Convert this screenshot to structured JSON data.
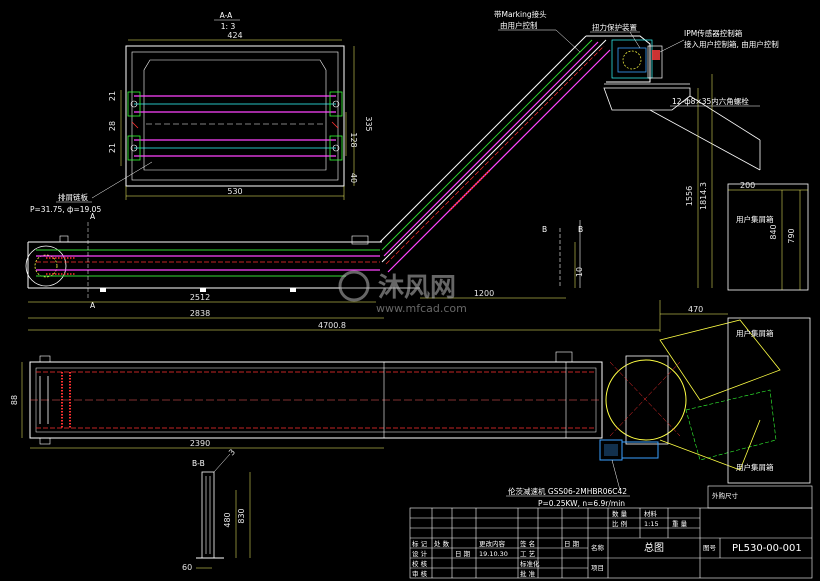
{
  "colors": {
    "background": "#000000",
    "outline": "#ffffff",
    "chain": "#ff3030",
    "belt": "#ff44ff",
    "rail": "#33dd33",
    "centerline": "#ff6060",
    "dimension": "#ffff66",
    "cyan": "#33ffff",
    "motor": "#3aa0ff",
    "guard": "#ffff44",
    "title_block": "#ffffff"
  },
  "section_aa": {
    "title": "A-A",
    "scale": "1: 3",
    "dims": {
      "top_width": "424",
      "bottom_width": "530",
      "right_335": "335",
      "right_128": "128",
      "right_40": "40",
      "left_21_top": "21",
      "left_28": "28",
      "left_21_bot": "21"
    }
  },
  "section_bb": {
    "title": "B-B",
    "dims": {
      "d_480": "480",
      "d_830": "830",
      "d_60": "60",
      "d_3": "3"
    }
  },
  "side_view": {
    "dims": {
      "d_2512": "2512",
      "d_2838": "2838",
      "d_4700": "4700.8",
      "d_1200": "1200",
      "d_10": "10",
      "d_1556": "1556",
      "d_1814": "1814.3",
      "d_200": "200",
      "d_840": "840",
      "d_790": "790",
      "d_470": "470"
    },
    "markers": {
      "a_top": "A",
      "a_bot": "A",
      "b_left": "B",
      "b_right": "B"
    }
  },
  "top_view": {
    "dims": {
      "d_2390": "2390",
      "d_left": "88"
    }
  },
  "annotations": {
    "chain_plate_1": "排屑链板",
    "chain_plate_2": "P=31.75, ф=19.05",
    "marking_1": "带Marking接头",
    "marking_2": "由用户控制",
    "torque_limiter": "扭力保护装置",
    "ipm_1": "IPM传感器控制箱",
    "ipm_2": "接入用户控制箱, 由用户控制",
    "bolts": "12-ф8×35内六角螺栓",
    "user_box_1": "用户集屑箱",
    "user_box_2": "用户集屑箱",
    "user_box_3": "用户集屑箱",
    "motor_1": "伦茨减速机 GSS06-2MHBR06C42",
    "motor_2": "P=0.25KW, n=6.9r/min"
  },
  "title_block": {
    "drawing_name_label": "名称",
    "drawing_name": "总图",
    "drawing_no_label": "图号",
    "drawing_no": "PL530-00-001",
    "scale_label": "比 例",
    "scale_value": "1:15",
    "weight_label": "重 量",
    "project_label": "项目",
    "quantity_label": "数 量",
    "material_label": "材料",
    "row_labels": [
      "标 记",
      "处 数",
      "更改内容",
      "签 名",
      "日 期"
    ],
    "left_labels": [
      "设 计",
      "校 核",
      "审 核"
    ],
    "date_label": "日 期",
    "date_value": "19.10.30",
    "process_label": "工 艺",
    "standard_label": "标准化",
    "approve_label": "批 准",
    "note_right": "外购尺寸"
  },
  "watermark": {
    "cn": "沐风网",
    "en": "www.mfcad.com"
  }
}
